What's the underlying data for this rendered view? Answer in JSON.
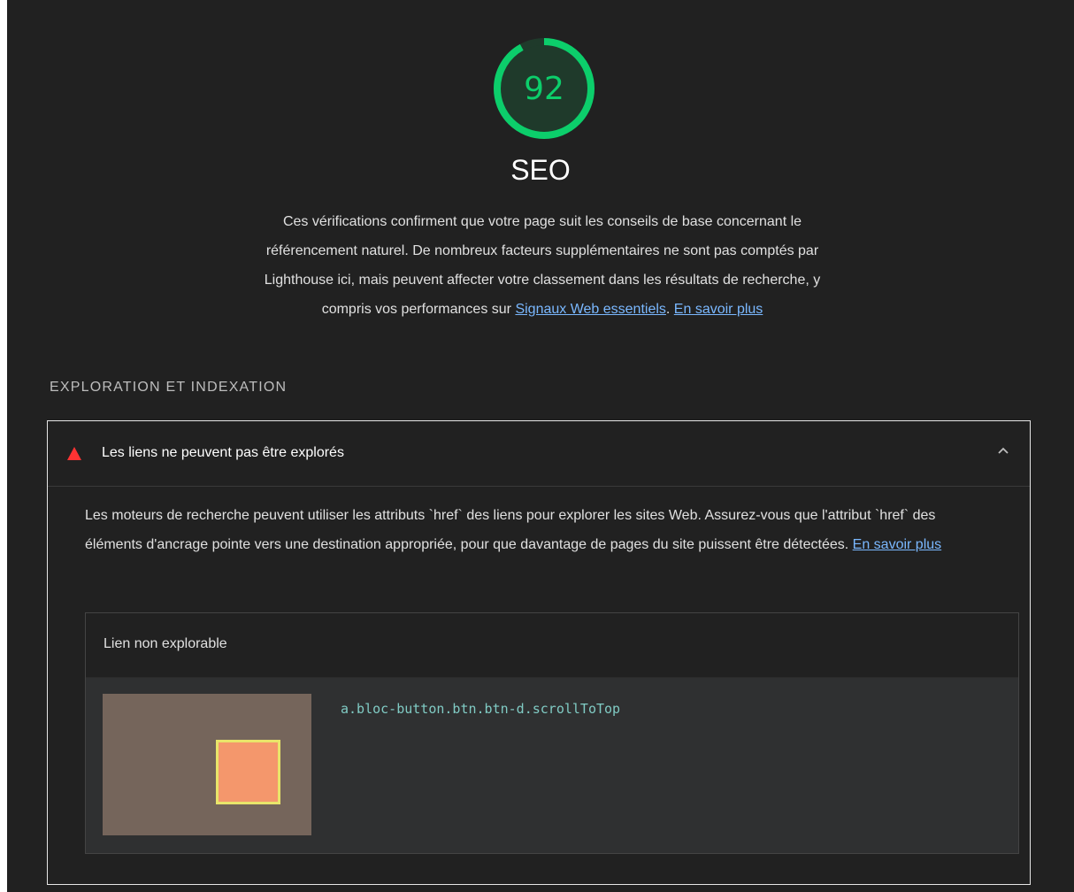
{
  "category": {
    "score": "92",
    "score_fraction": 0.92,
    "score_color": "#0cce6b",
    "title": "SEO",
    "description_text": "Ces vérifications confirment que votre page suit les conseils de base concernant le référencement naturel. De nombreux facteurs supplémentaires ne sont pas comptés par Lighthouse ici, mais peuvent affecter votre classement dans les résultats de recherche, y compris vos performances sur ",
    "cwv_link": "Signaux Web essentiels",
    "sep": ". ",
    "learn_more_link": "En savoir plus"
  },
  "group": {
    "title": "EXPLORATION ET INDEXATION"
  },
  "audit": {
    "status_icon": "fail-triangle-icon",
    "status_color": "#ff3333",
    "title": "Les liens ne peuvent pas être explorés",
    "expand_icon": "chevron-up-icon",
    "description_text": "Les moteurs de recherche peuvent utiliser les attributs `href` des liens pour explorer les sites Web. Assurez-vous que l'attribut `href` des éléments d'ancrage pointe vers une destination appropriée, pour que davantage de pages du site puissent être détectées. ",
    "learn_more_link": "En savoir plus",
    "table": {
      "column_header": "Lien non explorable",
      "rows": [
        {
          "selector": "a.bloc-button.btn.btn-d.scrollToTop"
        }
      ]
    }
  }
}
